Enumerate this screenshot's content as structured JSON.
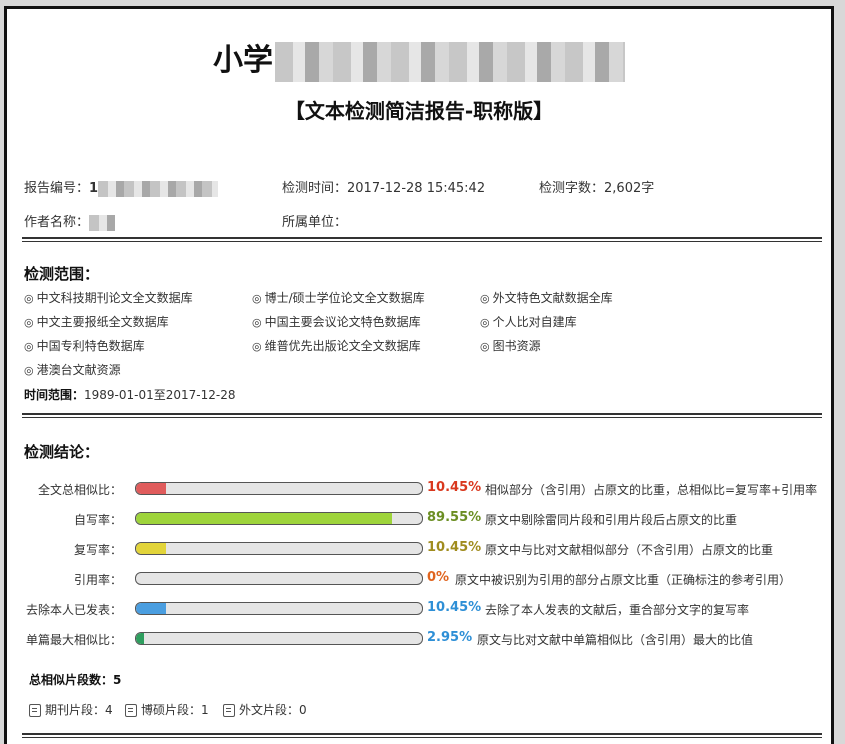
{
  "header": {
    "title_prefix": "小学",
    "subtitle": "【文本检测简洁报告-职称版】"
  },
  "meta": {
    "report_no_label": "报告编号：",
    "report_no_value": "1",
    "check_time_label": "检测时间：",
    "check_time_value": "2017-12-28 15:45:42",
    "word_count_label": "检测字数：",
    "word_count_value": "2,602字",
    "author_label": "作者名称：",
    "author_value": "",
    "unit_label": "所属单位：",
    "unit_value": ""
  },
  "scope": {
    "title": "检测范围：",
    "bullet": "◎",
    "databases": [
      "中文科技期刊论文全文数据库",
      "博士/硕士学位论文全文数据库",
      "外文特色文献数据全库",
      "中文主要报纸全文数据库",
      "中国主要会议论文特色数据库",
      "个人比对自建库",
      "中国专利特色数据库",
      "维普优先出版论文全文数据库",
      "图书资源",
      "港澳台文献资源"
    ],
    "time_range_label": "时间范围：",
    "time_range_value": "1989-01-01至2017-12-28"
  },
  "results": {
    "title": "检测结论：",
    "rows": [
      {
        "label": "全文总相似比：",
        "value": 10.45,
        "display": "10.45%",
        "color": "#e05c5c",
        "text_color": "#d9381e",
        "desc": "相似部分（含引用）占原文的比重，总相似比=复写率+引用率"
      },
      {
        "label": "自写率：",
        "value": 89.55,
        "display": "89.55%",
        "color": "#9ed43b",
        "text_color": "#6b8e23",
        "desc": "原文中剔除雷同片段和引用片段后占原文的比重"
      },
      {
        "label": "复写率：",
        "value": 10.45,
        "display": "10.45%",
        "color": "#e2d43a",
        "text_color": "#a08c1e",
        "desc": "原文中与比对文献相似部分（不含引用）占原文的比重"
      },
      {
        "label": "引用率：",
        "value": 0,
        "display": "0%",
        "color": "#e07a30",
        "text_color": "#e0641e",
        "desc": "原文中被识别为引用的部分占原文比重（正确标注的参考引用）"
      },
      {
        "label": "去除本人已发表：",
        "value": 10.45,
        "display": "10.45%",
        "color": "#4a9ee0",
        "text_color": "#2e8fd6",
        "desc": "去除了本人发表的文献后，重合部分文字的复写率"
      },
      {
        "label": "单篇最大相似比：",
        "value": 2.95,
        "display": "2.95%",
        "color": "#2e9e5e",
        "text_color": "#2e8fd6",
        "desc": "原文与比对文献中单篇相似比（含引用）最大的比值"
      }
    ],
    "total_label": "总相似片段数：",
    "total_value": "5",
    "fragments": [
      {
        "label": "期刊片段：",
        "value": "4"
      },
      {
        "label": "博硕片段：",
        "value": "1"
      },
      {
        "label": "外文片段：",
        "value": "0"
      }
    ]
  }
}
